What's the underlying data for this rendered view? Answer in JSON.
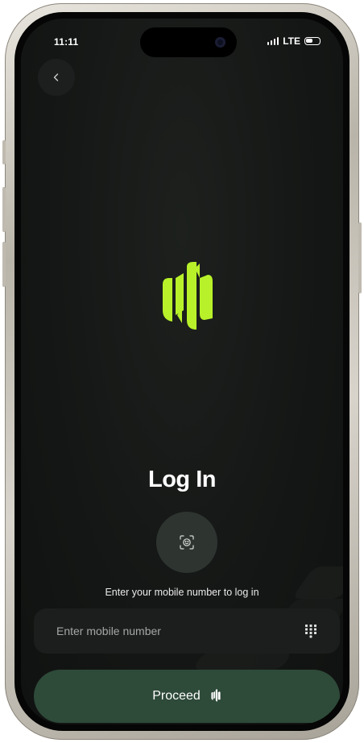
{
  "status_bar": {
    "time": "11:11",
    "network": "LTE"
  },
  "icons": {
    "back": "chevron-left-icon",
    "logo": "brand-logo",
    "face_id": "face-id-icon",
    "keypad": "keypad-icon",
    "proceed": "brand-mark-icon"
  },
  "login": {
    "title": "Log In",
    "subtitle": "Enter your mobile number to log in",
    "mobile_placeholder": "Enter mobile number",
    "mobile_value": "",
    "proceed_label": "Proceed"
  },
  "colors": {
    "accent": "#b8f12a",
    "background": "#151716",
    "proceed_button": "#2e4a39",
    "input_bg": "#1c1e1d"
  }
}
